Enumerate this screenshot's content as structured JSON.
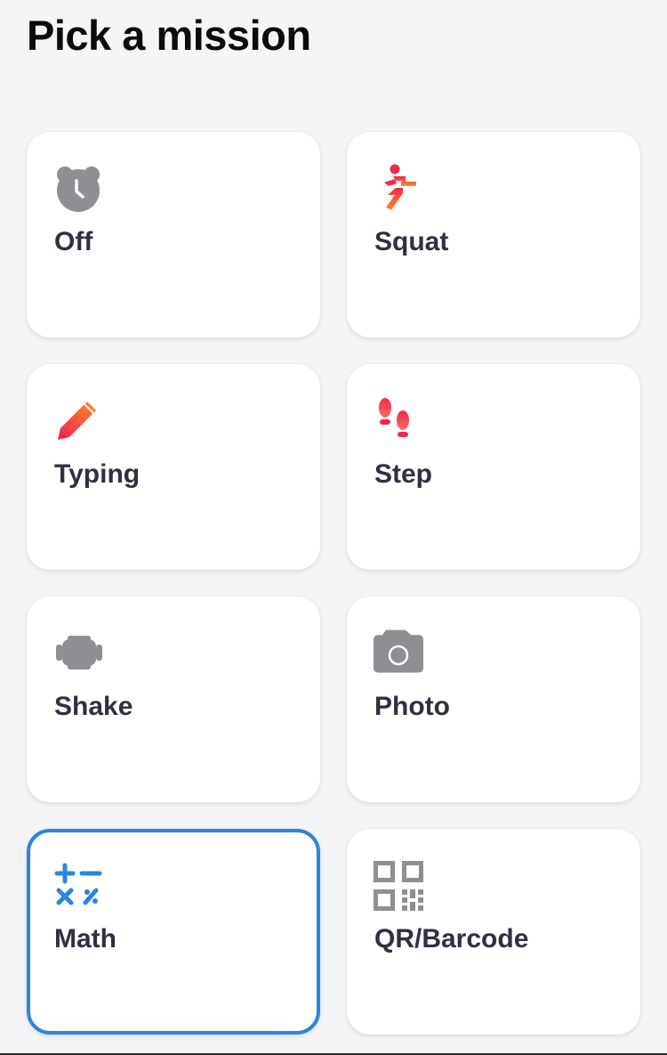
{
  "page": {
    "title": "Pick a mission"
  },
  "missions": [
    {
      "label": "Off",
      "icon": "alarm-clock-off-icon",
      "selected": false
    },
    {
      "label": "Squat",
      "icon": "squat-person-icon",
      "selected": false
    },
    {
      "label": "Typing",
      "icon": "pencil-icon",
      "selected": false
    },
    {
      "label": "Step",
      "icon": "footprints-icon",
      "selected": false
    },
    {
      "label": "Shake",
      "icon": "shake-phone-icon",
      "selected": false
    },
    {
      "label": "Photo",
      "icon": "camera-icon",
      "selected": false
    },
    {
      "label": "Math",
      "icon": "math-operators-icon",
      "selected": true
    },
    {
      "label": "QR/Barcode",
      "icon": "qr-code-icon",
      "selected": false
    }
  ],
  "colors": {
    "selected_border": "#2b86db",
    "label_text": "#2f3040",
    "inactive_icon": "#8e8e93",
    "accent_red": "#f03a55",
    "accent_orange": "#ff7a2f",
    "math_icon": "#2b86db"
  }
}
